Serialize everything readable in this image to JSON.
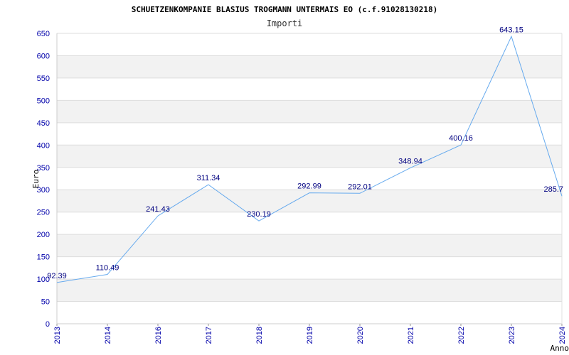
{
  "chart_data": {
    "type": "line",
    "title": "SCHUETZENKOMPANIE BLASIUS TROGMANN UNTERMAIS EO (c.f.91028130218)",
    "subtitle": "Importi",
    "xlabel": "Anno",
    "ylabel": "Euro",
    "x": [
      "2013",
      "2014",
      "2016",
      "2017",
      "2018",
      "2019",
      "2020",
      "2021",
      "2022",
      "2023",
      "2024"
    ],
    "series": [
      {
        "values": [
          92.39,
          110.49,
          241.43,
          311.34,
          230.19,
          292.99,
          292.01,
          348.94,
          400.16,
          643.15,
          285.7
        ],
        "labels": [
          "92.39",
          "110.49",
          "241.43",
          "311.34",
          "230.19",
          "292.99",
          "292.01",
          "348.94",
          "400.16",
          "643.15",
          "285.7"
        ]
      }
    ],
    "yticks": [
      0,
      50,
      100,
      150,
      200,
      250,
      300,
      350,
      400,
      450,
      500,
      550,
      600,
      650
    ],
    "ylim": [
      0,
      650
    ],
    "grid": true,
    "colors": {
      "line": "#66aaee",
      "band": "#f2f2f2",
      "grid": "#dddddd",
      "tick": "#0000aa",
      "label": "#000080"
    }
  }
}
